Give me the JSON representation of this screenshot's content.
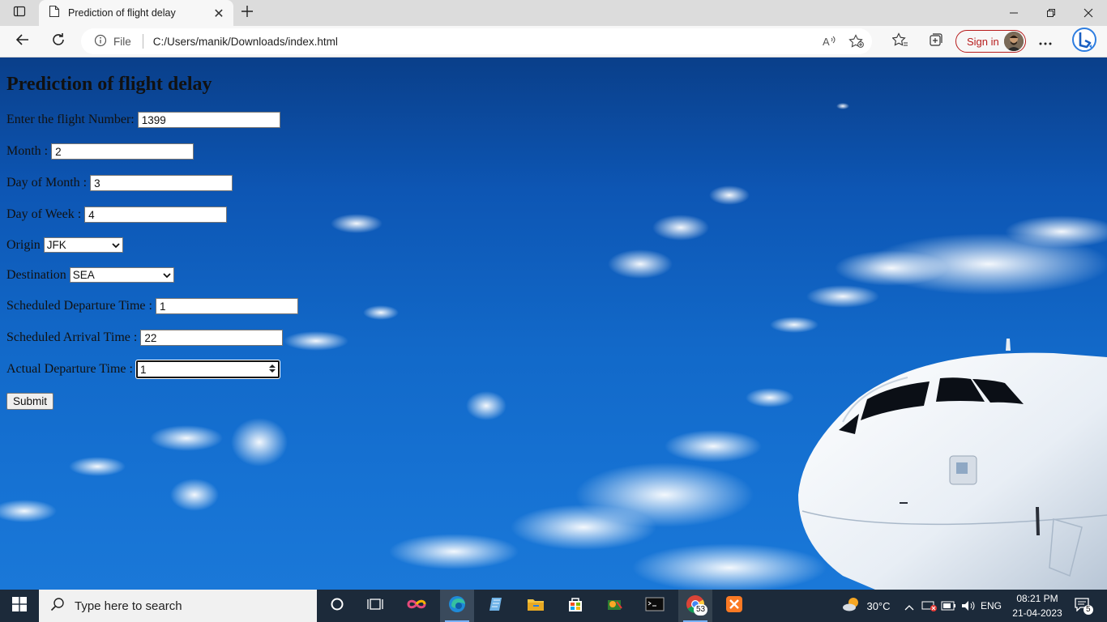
{
  "browser": {
    "tab_title": "Prediction of flight delay",
    "address_file_label": "File",
    "url": "C:/Users/manik/Downloads/index.html",
    "sign_in_label": "Sign in"
  },
  "page": {
    "title": "Prediction of flight delay",
    "fields": {
      "flight_number": {
        "label": "Enter the flight Number:",
        "value": "1399"
      },
      "month": {
        "label": "Month :",
        "value": "2"
      },
      "day_of_month": {
        "label": "Day of Month :",
        "value": "3"
      },
      "day_of_week": {
        "label": "Day of Week :",
        "value": "4"
      },
      "origin": {
        "label": "Origin",
        "value": "JFK"
      },
      "destination": {
        "label": "Destination",
        "value": "SEA"
      },
      "sched_dep": {
        "label": "Scheduled Departure Time :",
        "value": "1"
      },
      "sched_arr": {
        "label": "Scheduled Arrival Time :",
        "value": "22"
      },
      "actual_dep": {
        "label": "Actual Departure Time :",
        "value": "1"
      }
    },
    "submit_label": "Submit"
  },
  "taskbar": {
    "search_placeholder": "Type here to search",
    "chrome_badge": "53",
    "weather": "30°C",
    "language": "ENG",
    "time": "08:21 PM",
    "date": "21-04-2023",
    "notification_count": "5"
  },
  "colors": {
    "sky_top": "#0a3f8a",
    "sky_bottom": "#1a78d8",
    "signin_accent": "#b71c1c",
    "taskbar_bg": "#1c2a3a"
  },
  "icons": [
    "tab-actions-icon",
    "page-icon",
    "close-icon",
    "plus-icon",
    "minimize-icon",
    "restore-icon",
    "window-close-icon",
    "back-icon",
    "refresh-icon",
    "info-icon",
    "read-aloud-icon",
    "add-favorite-icon",
    "favorites-icon",
    "collections-icon",
    "more-icon",
    "bing-icon",
    "windows-icon",
    "search-icon",
    "cortana-icon",
    "task-view-icon",
    "edge-icon",
    "file-explorer-icon",
    "store-icon",
    "chrome-icon",
    "weather-icon",
    "chevron-up-icon",
    "battery-icon",
    "volume-icon",
    "notification-icon"
  ]
}
